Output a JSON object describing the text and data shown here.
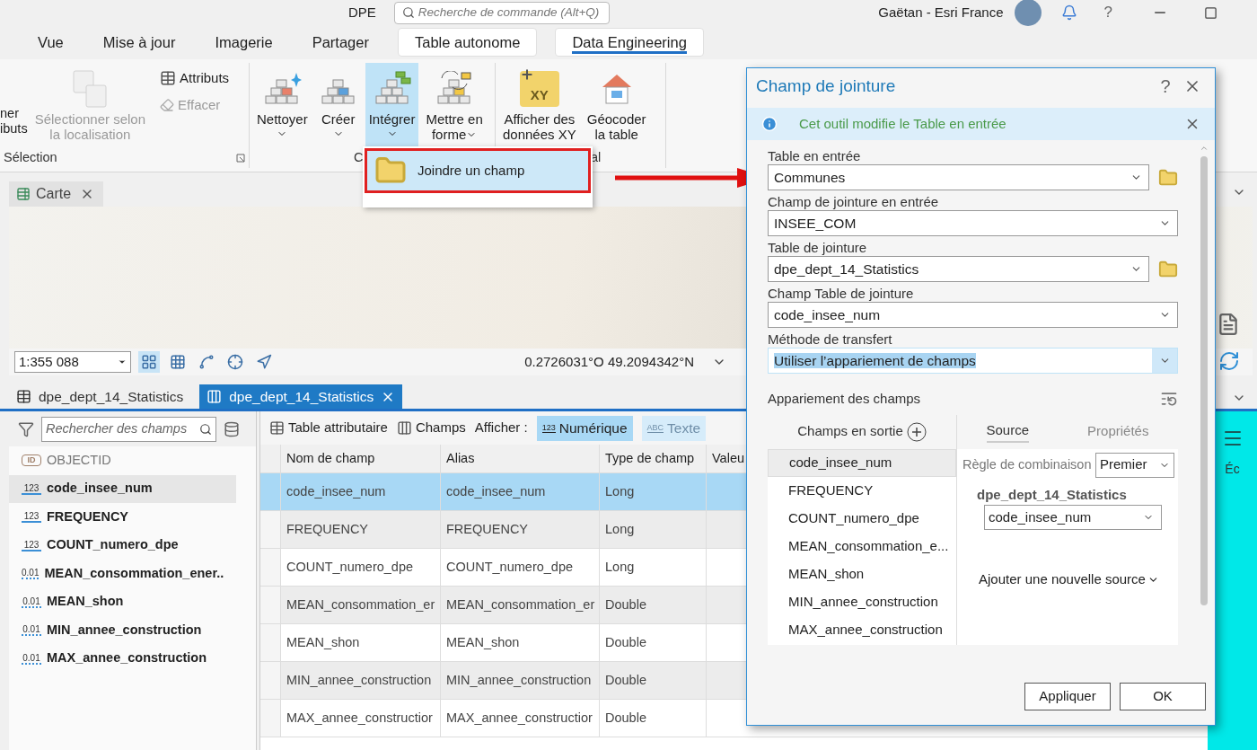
{
  "title_bar": {
    "project": "DPE",
    "search_placeholder": "Recherche de commande (Alt+Q)",
    "user": "Gaëtan - Esri France",
    "help": "?"
  },
  "ribbon_tabs": [
    {
      "label": "Vue",
      "selected": false,
      "contextual": false
    },
    {
      "label": "Mise à jour",
      "selected": false,
      "contextual": false
    },
    {
      "label": "Imagerie",
      "selected": false,
      "contextual": false
    },
    {
      "label": "Partager",
      "selected": false,
      "contextual": false
    },
    {
      "label": "Table autonome",
      "selected": false,
      "contextual": true
    },
    {
      "label": "Data Engineering",
      "selected": true,
      "contextual": true
    }
  ],
  "ribbon_groups": [
    {
      "label": "Sélection",
      "launcher": true,
      "tools": [
        {
          "kind": "text",
          "lines": [
            "ner",
            "ibuts"
          ]
        },
        {
          "kind": "large",
          "lines": [
            "Sélectionner selon",
            "la localisation"
          ],
          "disabled": true,
          "pressed": false,
          "menu": false
        },
        {
          "kind": "stack",
          "items": [
            {
              "label": "Attributs",
              "disabled": false
            },
            {
              "label": "Effacer",
              "disabled": true
            }
          ]
        }
      ]
    },
    {
      "label": "C",
      "launcher": false,
      "tools": [
        {
          "kind": "large",
          "lines": [
            "Nettoyer"
          ],
          "menu": true,
          "disabled": false,
          "pressed": false
        },
        {
          "kind": "large",
          "lines": [
            "Créer"
          ],
          "menu": true,
          "disabled": false,
          "pressed": false
        },
        {
          "kind": "large",
          "lines": [
            "Intégrer"
          ],
          "menu": true,
          "disabled": false,
          "pressed": true
        },
        {
          "kind": "large",
          "lines": [
            "Mettre en",
            "forme"
          ],
          "menu": true,
          "disabled": false,
          "pressed": false
        }
      ]
    },
    {
      "label": "al",
      "launcher": false,
      "tools": [
        {
          "kind": "large",
          "icon_text": "XY",
          "lines": [
            "Afficher des",
            "données XY"
          ],
          "disabled": false,
          "pressed": false,
          "menu": false
        },
        {
          "kind": "large",
          "lines": [
            "Géocoder",
            "la table"
          ],
          "disabled": false,
          "pressed": false,
          "menu": false
        }
      ]
    }
  ],
  "dropdown_menu": {
    "items": [
      {
        "label": "Joindre un champ",
        "highlighted": true
      }
    ]
  },
  "map": {
    "tab": "Carte",
    "scale": "1:355 088",
    "coordinates": "0.2726031°O 49.2094342°N",
    "tools": [
      {
        "selected": true
      },
      {
        "selected": false
      },
      {
        "selected": false
      },
      {
        "selected": false
      },
      {
        "selected": false
      }
    ]
  },
  "view_tabs": [
    {
      "label": "dpe_dept_14_Statistics",
      "selected": false
    },
    {
      "label": "dpe_dept_14_Statistics",
      "selected": true
    }
  ],
  "fields_panel": {
    "search_placeholder": "Rechercher des champs",
    "fields": [
      {
        "kind": "id",
        "badge": "ID",
        "name": "OBJECTID",
        "selected": false,
        "disabled": true
      },
      {
        "kind": "integer",
        "badge": "123",
        "name": "code_insee_num",
        "selected": true,
        "disabled": false
      },
      {
        "kind": "integer",
        "badge": "123",
        "name": "FREQUENCY",
        "selected": false,
        "disabled": false
      },
      {
        "kind": "integer",
        "badge": "123",
        "name": "COUNT_numero_dpe",
        "selected": false,
        "disabled": false
      },
      {
        "kind": "double",
        "badge": "0.01",
        "name": "MEAN_consommation_ener..",
        "selected": false,
        "disabled": false
      },
      {
        "kind": "double",
        "badge": "0.01",
        "name": "MEAN_shon",
        "selected": false,
        "disabled": false
      },
      {
        "kind": "double",
        "badge": "0.01",
        "name": "MIN_annee_construction",
        "selected": false,
        "disabled": false
      },
      {
        "kind": "double",
        "badge": "0.01",
        "name": "MAX_annee_construction",
        "selected": false,
        "disabled": false
      }
    ]
  },
  "fields_toolbar": [
    {
      "kind": "view",
      "label": "Table attributaire"
    },
    {
      "kind": "view",
      "label": "Champs"
    },
    {
      "kind": "label",
      "label": "Afficher :"
    },
    {
      "kind": "filter",
      "badge": "123",
      "label": "Numérique",
      "disabled": false
    },
    {
      "kind": "filter",
      "badge": "ABC",
      "label": "Texte",
      "disabled": true
    }
  ],
  "fields_table": {
    "columns": [
      "Nom de champ",
      "Alias",
      "Type de champ",
      "Valeu"
    ],
    "rows": [
      {
        "cells": [
          "code_insee_num",
          "code_insee_num",
          "Long"
        ],
        "selected": true
      },
      {
        "cells": [
          "FREQUENCY",
          "FREQUENCY",
          "Long"
        ],
        "selected": false
      },
      {
        "cells": [
          "COUNT_numero_dpe",
          "COUNT_numero_dpe",
          "Long"
        ],
        "selected": false
      },
      {
        "cells": [
          "MEAN_consommation_er",
          "MEAN_consommation_er",
          "Double"
        ],
        "selected": false
      },
      {
        "cells": [
          "MEAN_shon",
          "MEAN_shon",
          "Double"
        ],
        "selected": false
      },
      {
        "cells": [
          "MIN_annee_construction",
          "MIN_annee_construction",
          "Double"
        ],
        "selected": false
      },
      {
        "cells": [
          "MAX_annee_constructior",
          "MAX_annee_constructior",
          "Double"
        ],
        "selected": false
      }
    ]
  },
  "right_pane": {
    "fragment": "Éc"
  },
  "dialog": {
    "title": "Champ de jointure",
    "help": "?",
    "info": "Cet outil modifie le Table en entrée",
    "params": [
      {
        "label": "Table en entrée",
        "value": "Communes",
        "browse": true,
        "highlighted": false
      },
      {
        "label": "Champ de jointure en entrée",
        "value": "INSEE_COM",
        "browse": false,
        "highlighted": false
      },
      {
        "label": "Table de jointure",
        "value": "dpe_dept_14_Statistics",
        "browse": true,
        "highlighted": false
      },
      {
        "label": "Champ Table de jointure",
        "value": "code_insee_num",
        "browse": false,
        "highlighted": false
      },
      {
        "label": "Méthode de transfert",
        "value": "Utiliser l’appariement de champs",
        "browse": false,
        "highlighted": true
      }
    ],
    "field_mapping": {
      "title": "Appariement des champs",
      "output_header": "Champs en sortie",
      "output_fields": [
        {
          "name": "code_insee_num",
          "selected": true
        },
        {
          "name": "FREQUENCY",
          "selected": false
        },
        {
          "name": "COUNT_numero_dpe",
          "selected": false
        },
        {
          "name": "MEAN_consommation_e...",
          "selected": false
        },
        {
          "name": "MEAN_shon",
          "selected": false
        },
        {
          "name": "MIN_annee_construction",
          "selected": false
        },
        {
          "name": "MAX_annee_construction",
          "selected": false
        }
      ],
      "tabs": [
        {
          "label": "Source",
          "selected": true
        },
        {
          "label": "Propriétés",
          "selected": false
        }
      ],
      "merge_rule_label": "Règle de combinaison",
      "merge_rule": "Premier",
      "source_table": "dpe_dept_14_Statistics",
      "source_field": "code_insee_num",
      "add_source": "Ajouter une nouvelle source"
    },
    "buttons": [
      "Appliquer",
      "OK"
    ]
  }
}
